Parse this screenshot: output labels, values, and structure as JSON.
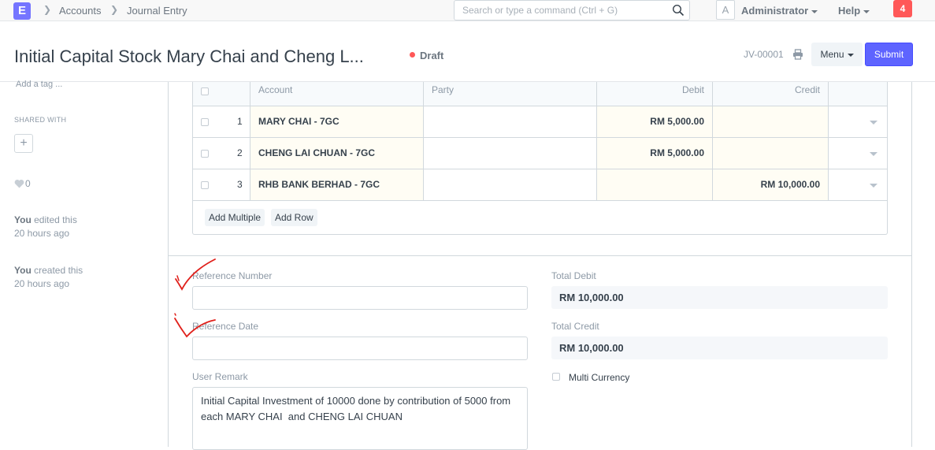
{
  "navbar": {
    "app_initial": "E",
    "breadcrumbs": [
      "Accounts",
      "Journal Entry"
    ],
    "search_placeholder": "Search or type a command (Ctrl + G)",
    "avatar_initial": "A",
    "user_label": "Administrator",
    "help_label": "Help",
    "notification_count": "4"
  },
  "page": {
    "title": "Initial Capital Stock Mary Chai and Cheng L...",
    "status": "Draft",
    "doc_id": "JV-00001",
    "menu_label": "Menu",
    "submit_label": "Submit"
  },
  "sidebar": {
    "add_tag": "Add a tag ...",
    "shared_with": "SHARED WITH",
    "add_share_symbol": "+",
    "like_count": "0",
    "activity": [
      {
        "who": "You",
        "action": " edited this",
        "when": "20 hours ago"
      },
      {
        "who": "You",
        "action": " created this",
        "when": "20 hours ago"
      }
    ]
  },
  "accounts_table": {
    "headers": {
      "account": "Account",
      "party": "Party",
      "debit": "Debit",
      "credit": "Credit"
    },
    "rows": [
      {
        "idx": "1",
        "account": "MARY CHAI - 7GC",
        "party": "",
        "debit": "RM 5,000.00",
        "credit": ""
      },
      {
        "idx": "2",
        "account": "CHENG LAI CHUAN - 7GC",
        "party": "",
        "debit": "RM 5,000.00",
        "credit": ""
      },
      {
        "idx": "3",
        "account": "RHB BANK BERHAD - 7GC",
        "party": "",
        "debit": "",
        "credit": "RM 10,000.00"
      }
    ],
    "add_multiple_label": "Add Multiple",
    "add_row_label": "Add Row"
  },
  "form": {
    "reference_number_label": "Reference Number",
    "reference_number_value": "",
    "reference_date_label": "Reference Date",
    "reference_date_value": "",
    "user_remark_label": "User Remark",
    "user_remark_value": "Initial Capital Investment of 10000 done by contribution of 5000 from each MARY CHAI  and CHENG LAI CHUAN",
    "total_debit_label": "Total Debit",
    "total_debit_value": "RM 10,000.00",
    "total_credit_label": "Total Credit",
    "total_credit_value": "RM 10,000.00",
    "multi_currency_label": "Multi Currency",
    "multi_currency_checked": false
  },
  "colors": {
    "primary": "#5e64ff",
    "draft_indicator": "#ff5858",
    "annotation": "#e0201b"
  },
  "icons": [
    "search-icon",
    "print-icon",
    "heart-icon",
    "chevron-right-icon",
    "caret-down-icon"
  ]
}
